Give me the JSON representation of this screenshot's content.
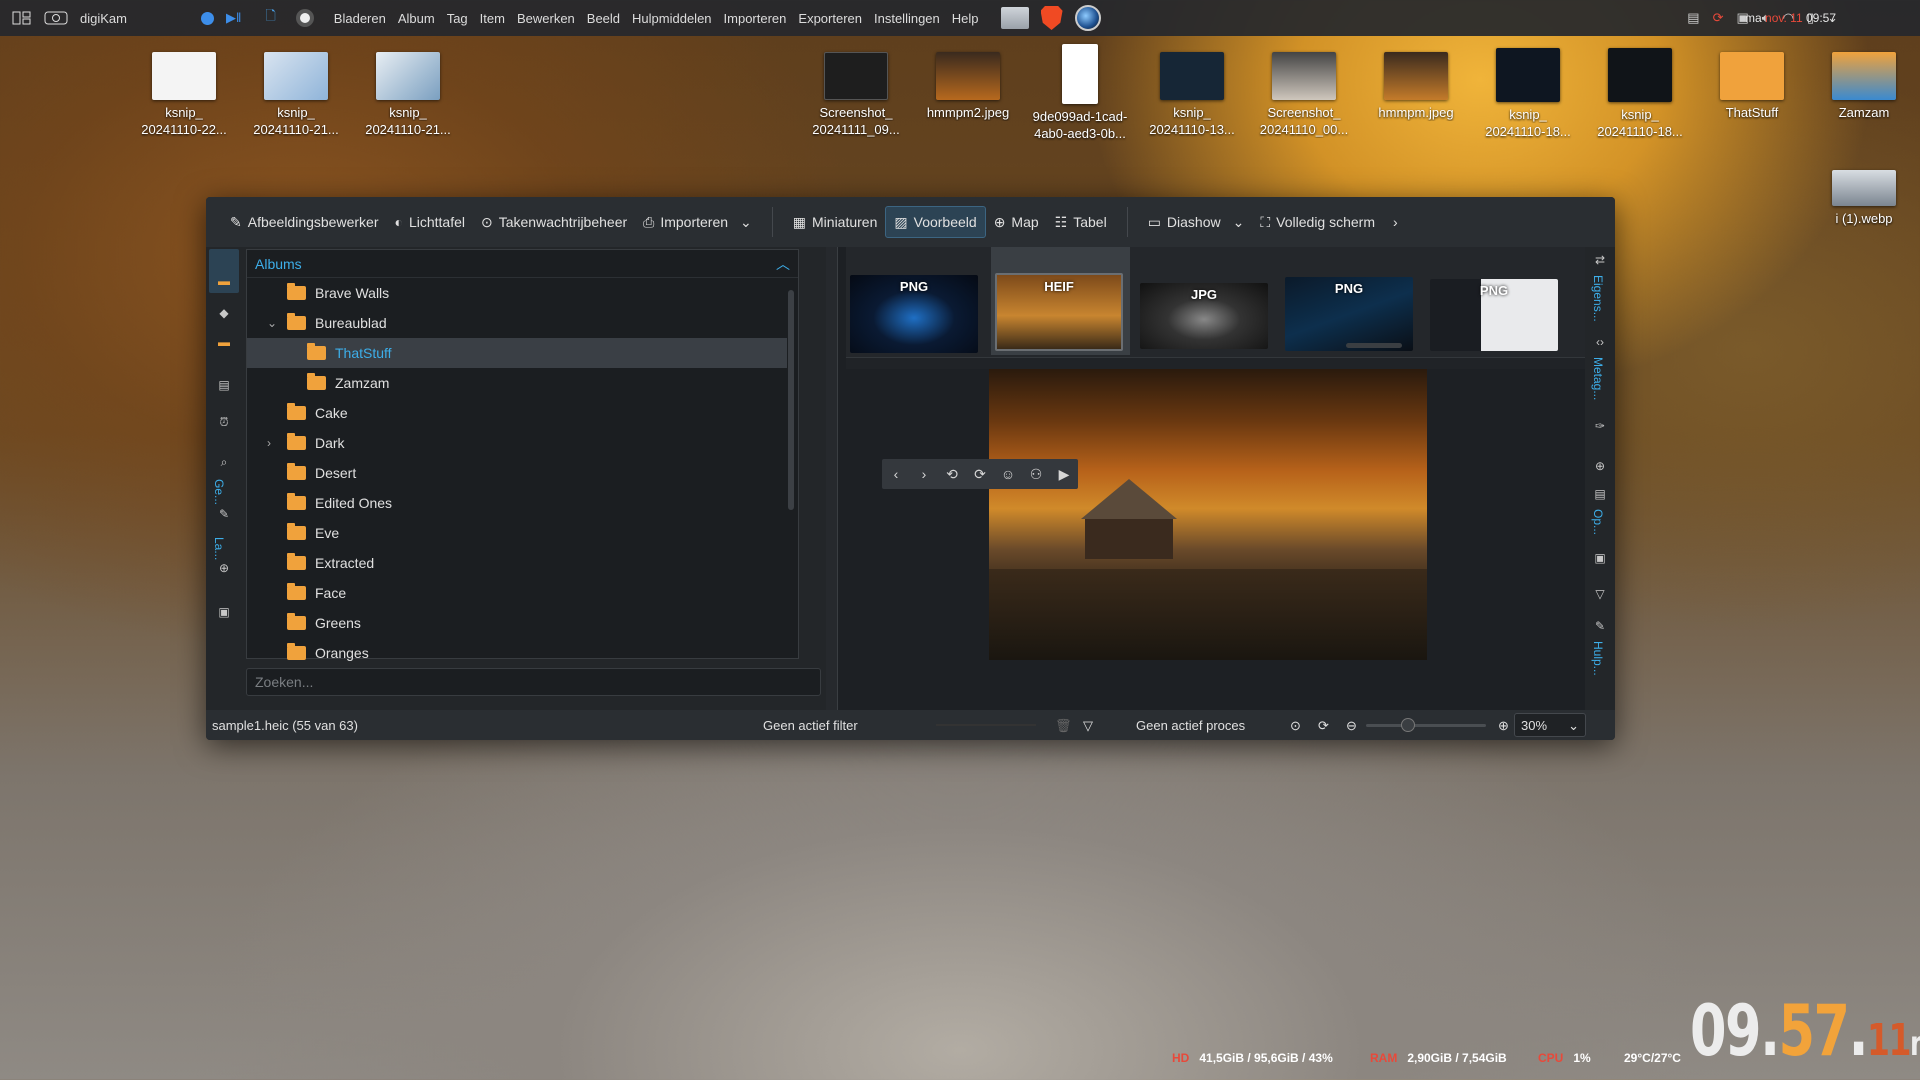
{
  "taskbar": {
    "app_name": "digiKam",
    "menus": [
      "Bladeren",
      "Album",
      "Tag",
      "Item",
      "Bewerken",
      "Beeld",
      "Hulpmiddelen",
      "Importeren",
      "Exporteren",
      "Instellingen",
      "Help"
    ],
    "date_prefix": "ma",
    "date": "nov. 11",
    "time": "09:57"
  },
  "desktop_icons": [
    {
      "label1": "ksnip_",
      "label2": "20241110-22..."
    },
    {
      "label1": "ksnip_",
      "label2": "20241110-21..."
    },
    {
      "label1": "ksnip_",
      "label2": "20241110-21..."
    },
    {
      "label1": "Screenshot_",
      "label2": "20241111_09..."
    },
    {
      "label1": "hmmpm2.jpeg",
      "label2": ""
    },
    {
      "label1": "9de099ad-1cad-",
      "label2": "4ab0-aed3-0b..."
    },
    {
      "label1": "ksnip_",
      "label2": "20241110-13..."
    },
    {
      "label1": "Screenshot_",
      "label2": "20241110_00..."
    },
    {
      "label1": "hmmpm.jpeg",
      "label2": ""
    },
    {
      "label1": "ksnip_",
      "label2": "20241110-18..."
    },
    {
      "label1": "ksnip_",
      "label2": "20241110-18..."
    },
    {
      "label1": "ThatStuff",
      "label2": ""
    },
    {
      "label1": "Zamzam",
      "label2": ""
    },
    {
      "label1": "i (1).webp",
      "label2": ""
    }
  ],
  "toolbar": {
    "image_editor": "Afbeeldingsbewerker",
    "light_table": "Lichttafel",
    "queue_manager": "Takenwachtrijbeheer",
    "import": "Importeren",
    "thumbnails": "Miniaturen",
    "preview": "Voorbeeld",
    "map": "Map",
    "table": "Tabel",
    "slideshow": "Diashow",
    "fullscreen": "Volledig scherm"
  },
  "left_tabs": {
    "geo": "Ge...",
    "labels": "La..."
  },
  "albums": {
    "header": "Albums",
    "items": [
      {
        "name": "Brave Walls",
        "level": 0,
        "expander": ""
      },
      {
        "name": "Bureaublad",
        "level": 0,
        "expander": "expanded"
      },
      {
        "name": "ThatStuff",
        "level": 1,
        "expander": "",
        "selected": true
      },
      {
        "name": "Zamzam",
        "level": 1,
        "expander": ""
      },
      {
        "name": "Cake",
        "level": 0,
        "expander": ""
      },
      {
        "name": "Dark",
        "level": 0,
        "expander": "collapsed"
      },
      {
        "name": "Desert",
        "level": 0,
        "expander": ""
      },
      {
        "name": "Edited Ones",
        "level": 0,
        "expander": ""
      },
      {
        "name": "Eve",
        "level": 0,
        "expander": ""
      },
      {
        "name": "Extracted",
        "level": 0,
        "expander": ""
      },
      {
        "name": "Face",
        "level": 0,
        "expander": ""
      },
      {
        "name": "Greens",
        "level": 0,
        "expander": ""
      },
      {
        "name": "Oranges",
        "level": 0,
        "expander": ""
      }
    ],
    "search_placeholder": "Zoeken..."
  },
  "filmstrip": [
    {
      "format": "PNG"
    },
    {
      "format": "HEIF",
      "selected": true
    },
    {
      "format": "JPG"
    },
    {
      "format": "PNG"
    },
    {
      "format": "PNG"
    }
  ],
  "right_tabs": {
    "properties": "Eigens...",
    "metadata": "Metag...",
    "options": "Op...",
    "tools": "Hulp..."
  },
  "status": {
    "file": "sample1.heic (55 van 63)",
    "filter": "Geen actief filter",
    "process": "Geen actief proces",
    "zoom": "30%",
    "zoom_fraction": 0.35
  },
  "system_monitor": {
    "hd_label": "HD",
    "hd_value": "41,5GiB / 95,6GiB / 43%",
    "ram_label": "RAM",
    "ram_value": "2,90GiB / 7,54GiB",
    "cpu_label": "CPU",
    "cpu_value": "1%",
    "temp_value": "29°C/27°C"
  },
  "big_clock": {
    "hh": "09",
    "mm": "57",
    "dd": "11",
    "day": "ma"
  },
  "colors": {
    "accent": "#3daee9",
    "folder": "#f0a23c",
    "window_bg": "#232629"
  }
}
